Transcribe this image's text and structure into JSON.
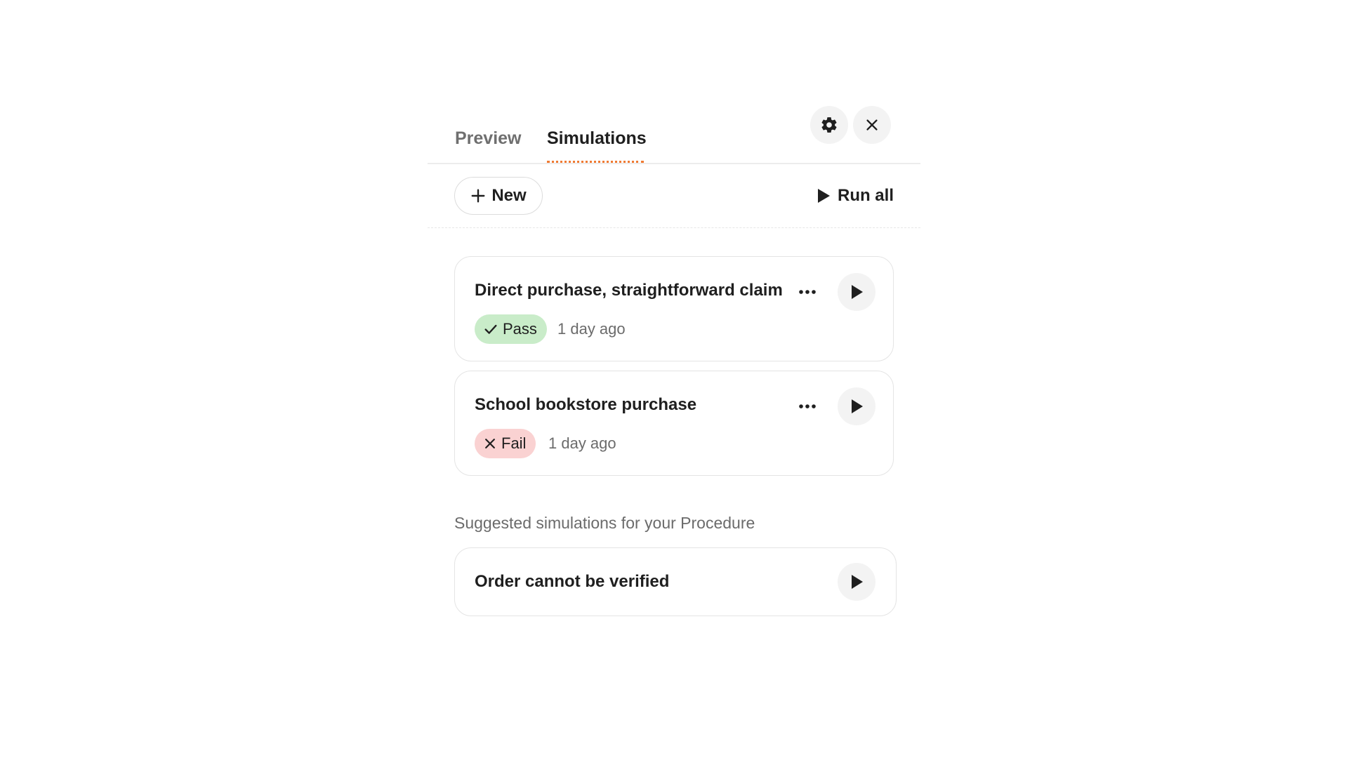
{
  "tabs": [
    {
      "label": "Preview",
      "active": false
    },
    {
      "label": "Simulations",
      "active": true
    }
  ],
  "header": {
    "settings_icon": "gear-icon",
    "close_icon": "close-icon",
    "accent_color": "#f07a32"
  },
  "toolbar": {
    "new_label": "New",
    "new_icon": "plus-icon",
    "run_all_label": "Run all",
    "run_all_icon": "play-icon"
  },
  "simulations": [
    {
      "title": "Direct purchase, straightforward claim",
      "status": "Pass",
      "status_icon": "check-icon",
      "status_color": "#c9ecc9",
      "timestamp": "1 day ago"
    },
    {
      "title": "School bookstore purchase",
      "status": "Fail",
      "status_icon": "x-icon",
      "status_color": "#fad2d2",
      "timestamp": "1 day ago"
    }
  ],
  "suggested": {
    "heading": "Suggested simulations for your Procedure",
    "items": [
      {
        "title": "Order cannot be verified"
      }
    ]
  }
}
